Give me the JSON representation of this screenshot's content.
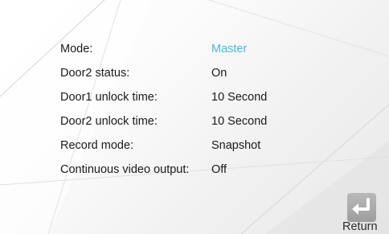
{
  "settings": [
    {
      "label": "Mode:",
      "value": "Master"
    },
    {
      "label": "Door2 status:",
      "value": "On"
    },
    {
      "label": "Door1 unlock time:",
      "value": "10 Second"
    },
    {
      "label": "Door2 unlock time:",
      "value": "10 Second"
    },
    {
      "label": "Record mode:",
      "value": "Snapshot"
    },
    {
      "label": "Continuous video output:",
      "value": "Off"
    }
  ],
  "selected_value_color": "#4cb6db",
  "return_button": {
    "label": "Return",
    "icon": "return-arrow-icon"
  }
}
